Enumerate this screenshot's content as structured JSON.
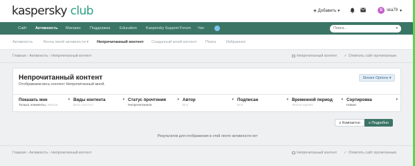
{
  "brand": {
    "part1": "kaspersky",
    "part2": " club"
  },
  "header": {
    "add_label": "Добавить",
    "user_name": "ska79",
    "avatar_letter": "S"
  },
  "nav": {
    "items": [
      {
        "label": "Сайт",
        "active": false
      },
      {
        "label": "Активность",
        "active": true
      },
      {
        "label": "Магазин",
        "active": false
      },
      {
        "label": "Поддержка",
        "active": false
      },
      {
        "label": "Education",
        "active": false
      },
      {
        "label": "Kaspersky Support Forum",
        "active": false
      },
      {
        "label": "Чат",
        "active": false
      }
    ],
    "search_placeholder": "Поиск..."
  },
  "subnav": {
    "items": [
      {
        "label": "Активность",
        "active": false
      },
      {
        "label": "Ленты моей активности",
        "active": false
      },
      {
        "label": "Непрочитанный контент",
        "active": true
      },
      {
        "label": "Созданный мной контент",
        "active": false
      },
      {
        "label": "Поиск",
        "active": false
      },
      {
        "label": "Избранное",
        "active": false
      }
    ]
  },
  "breadcrumb": {
    "items": [
      "Главная",
      "Активность",
      "Непрочитанный контент"
    ]
  },
  "right_links": {
    "unread": "Непрочитанный контент",
    "mark_read": "Отметить сайт прочитанным"
  },
  "panel": {
    "title": "Непрочитанный контент",
    "subtitle": "Отображаем весь контент Непрочитанный мной.",
    "stream_options": "Stream Options"
  },
  "filters": [
    {
      "label": "Показать мне",
      "value": "Только элементы",
      "placeholder": "Любой"
    },
    {
      "label": "Виды контента",
      "value": "",
      "placeholder": "Весь контент"
    },
    {
      "label": "Статус прочтения",
      "value": "Непрочитанное",
      "placeholder": ""
    },
    {
      "label": "Автор",
      "value": "",
      "placeholder": "Все"
    },
    {
      "label": "Подписан",
      "value": "",
      "placeholder": "Все"
    },
    {
      "label": "Временной период",
      "value": "",
      "placeholder": "Любой время"
    },
    {
      "label": "Сортировка",
      "value": "Новое",
      "placeholder": ""
    }
  ],
  "view_toggle": {
    "compact": "Компактно",
    "detailed": "Подробно"
  },
  "empty_message": "Результатов для отображения в этой ленте активности нет",
  "colors": {
    "nav_green": "#3b7566",
    "brand_green": "#2b9e80",
    "avatar": "#c25fc9"
  }
}
